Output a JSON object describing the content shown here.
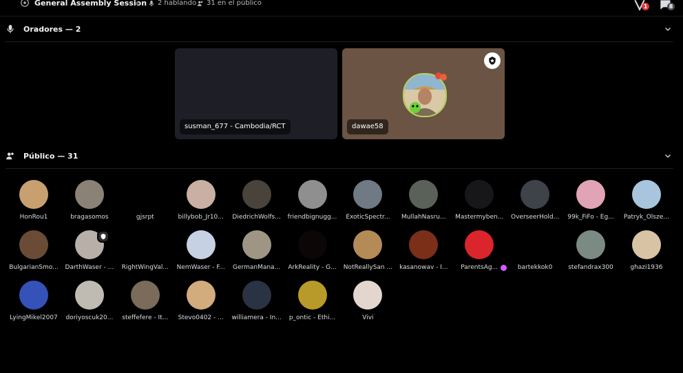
{
  "topbar": {
    "title": "General Assembly Session",
    "speaking": "2 hablando",
    "audience": "31 en el público",
    "notif_badge_1": "1",
    "notif_badge_2": "8"
  },
  "speakers": {
    "header": "Oradores — 2",
    "tiles": [
      {
        "label": "susman_677 - Cambodia/RCT",
        "bg": "#1e1f26"
      },
      {
        "label": "dawae58",
        "bg": "#6b5443"
      }
    ]
  },
  "audience": {
    "header": "Público — 31",
    "members": [
      {
        "name": "HonRou1",
        "color": "#c8a070"
      },
      {
        "name": "bragasomos",
        "color": "#8a8277"
      },
      {
        "name": "gjsrpt",
        "color": "#000000"
      },
      {
        "name": "billybob_Jr10...",
        "color": "#c9b0a3"
      },
      {
        "name": "DiedrichWolfs...",
        "color": "#4a433c"
      },
      {
        "name": "friendbignugg...",
        "color": "#8f8f8f"
      },
      {
        "name": "ExoticSpectr...",
        "color": "#6f7a84"
      },
      {
        "name": "MullahNasru...",
        "color": "#5a6158"
      },
      {
        "name": "Mastermyben...",
        "color": "#17171a"
      },
      {
        "name": "OverseerHold...",
        "color": "#3e434a"
      },
      {
        "name": "99k_FiFo - Eg...",
        "color": "#e0a4b6"
      },
      {
        "name": "Patryk_Olsze...",
        "color": "#a8c5dd"
      },
      {
        "name": "BulgarianSmo...",
        "color": "#6a4c36"
      },
      {
        "name": "DarthWaser - ...",
        "color": "#b8b0a8"
      },
      {
        "name": "RightWingVal...",
        "color": "#000000"
      },
      {
        "name": "NemWaser - F...",
        "color": "#c6d2e3"
      },
      {
        "name": "GermanMana...",
        "color": "#9e9584"
      },
      {
        "name": "ArkReality - G...",
        "color": "#0c0606"
      },
      {
        "name": "NotReallySan ...",
        "color": "#b48b57"
      },
      {
        "name": "kasanowav - I...",
        "color": "#7b2f18"
      },
      {
        "name": "ParentsAg...",
        "color": "#d9252b"
      },
      {
        "name": "bartekkok0",
        "color": "#000000"
      },
      {
        "name": "stefandrax300",
        "color": "#7b8a82"
      },
      {
        "name": "ghazi1936",
        "color": "#d8c3a5"
      },
      {
        "name": "LyingMikel2007",
        "color": "#3452b8"
      },
      {
        "name": "doriyoscuk20...",
        "color": "#c0bbb2"
      },
      {
        "name": "steffefere - It...",
        "color": "#7a6b5a"
      },
      {
        "name": "Stevo0402 - ...",
        "color": "#d2ac7c"
      },
      {
        "name": "williamera - In...",
        "color": "#2a3344"
      },
      {
        "name": "p_ontic - Ethi...",
        "color": "#b89a2a"
      },
      {
        "name": "Vivi",
        "color": "#e3d6cf"
      }
    ]
  }
}
